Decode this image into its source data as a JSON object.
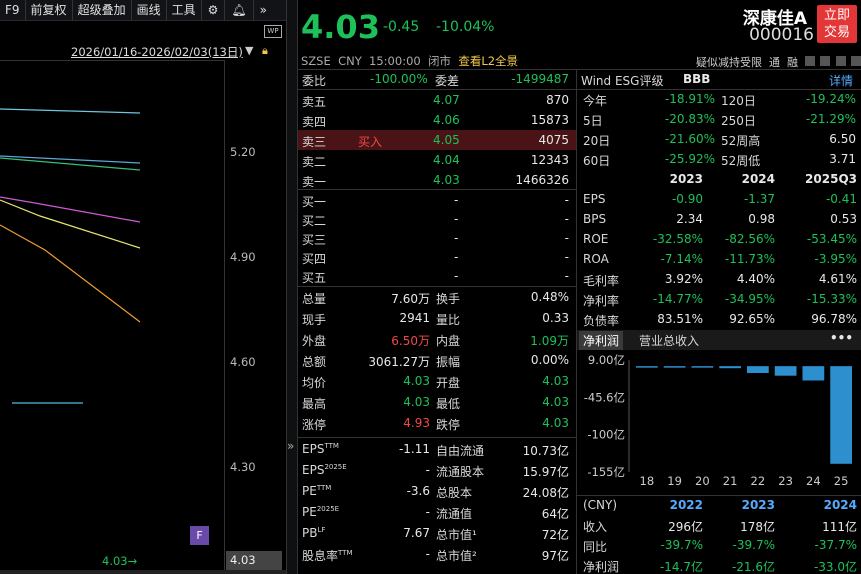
{
  "toolbar": {
    "f9": "F9",
    "restore": "前复权",
    "overlay": "超级叠加",
    "draw": "画线",
    "tools": "工具"
  },
  "chart": {
    "date_range": "2026/01/16-2026/02/03(13日)",
    "y_ticks": [
      "5.20",
      "4.90",
      "4.60",
      "4.30"
    ],
    "last_label": "4.03",
    "last_arrow": "4.03→",
    "f_marker": "F"
  },
  "header": {
    "price": "4.03",
    "change": "-0.45",
    "change_pct": "-10.04%",
    "name": "深康佳A",
    "code": "000016",
    "trade_btn_line1": "立即",
    "trade_btn_line2": "交易",
    "exchange": "SZSE",
    "currency": "CNY",
    "time": "15:00:00",
    "status": "闭市",
    "l2": "查看L2全景",
    "notice": "疑似减持受限",
    "notice2": "通",
    "notice3": "融"
  },
  "book": {
    "ratio_label": "委比",
    "ratio_value": "-100.00%",
    "diff_label": "委差",
    "diff_value": "-1499487",
    "asks": [
      {
        "label": "卖五",
        "price": "4.07",
        "vol": "870"
      },
      {
        "label": "卖四",
        "price": "4.06",
        "vol": "15873"
      },
      {
        "label": "卖三",
        "tag": "买入",
        "price": "4.05",
        "vol": "4075"
      },
      {
        "label": "卖二",
        "price": "4.04",
        "vol": "12343"
      },
      {
        "label": "卖一",
        "price": "4.03",
        "vol": "1466326"
      }
    ],
    "bids": [
      {
        "label": "买一",
        "price": "-",
        "vol": "-"
      },
      {
        "label": "买二",
        "price": "-",
        "vol": "-"
      },
      {
        "label": "买三",
        "price": "-",
        "vol": "-"
      },
      {
        "label": "买四",
        "price": "-",
        "vol": "-"
      },
      {
        "label": "买五",
        "price": "-",
        "vol": "-"
      }
    ]
  },
  "stats": [
    {
      "l1": "总量",
      "v1": "7.60万",
      "l2": "换手",
      "v2": "0.48%"
    },
    {
      "l1": "现手",
      "v1": "2941",
      "l2": "量比",
      "v2": "0.33"
    },
    {
      "l1": "外盘",
      "v1": "6.50万",
      "l2": "内盘",
      "v2": "1.09万"
    },
    {
      "l1": "总额",
      "v1": "3061.27万",
      "l2": "振幅",
      "v2": "0.00%"
    },
    {
      "l1": "均价",
      "v1": "4.03",
      "l2": "开盘",
      "v2": "4.03"
    },
    {
      "l1": "最高",
      "v1": "4.03",
      "l2": "最低",
      "v2": "4.03"
    },
    {
      "l1": "涨停",
      "v1": "4.93",
      "l2": "跌停",
      "v2": "4.03"
    }
  ],
  "val": [
    {
      "l1": "EPS",
      "s1": "TTM",
      "v1": "-1.11",
      "l2": "自由流通",
      "v2": "10.73亿"
    },
    {
      "l1": "EPS",
      "s1": "2025E",
      "v1": "-",
      "l2": "流通股本",
      "v2": "15.97亿"
    },
    {
      "l1": "PE",
      "s1": "TTM",
      "v1": "-3.6",
      "l2": "总股本",
      "v2": "24.08亿"
    },
    {
      "l1": "PE",
      "s1": "2025E",
      "v1": "-",
      "l2": "流通值",
      "v2": "64亿"
    },
    {
      "l1": "PB",
      "s1": "LF",
      "v1": "7.67",
      "l2": "总市值¹",
      "v2": "72亿"
    },
    {
      "l1": "股息率",
      "s1": "TTM",
      "v1": "-",
      "l2": "总市值²",
      "v2": "97亿"
    }
  ],
  "wind": {
    "title": "Wind ESG评级",
    "rating": "BBB",
    "detail": "详情",
    "perf": [
      {
        "l1": "今年",
        "v1": "-18.91%",
        "l2": "120日",
        "v2": "-19.24%"
      },
      {
        "l1": "5日",
        "v1": "-20.83%",
        "l2": "250日",
        "v2": "-21.29%"
      },
      {
        "l1": "20日",
        "v1": "-21.60%",
        "l2": "52周高",
        "v2": "6.50"
      },
      {
        "l1": "60日",
        "v1": "-25.92%",
        "l2": "52周低",
        "v2": "3.71"
      }
    ],
    "years": [
      "2023",
      "2024",
      "2025Q3"
    ],
    "fin": [
      {
        "l": "EPS",
        "v": [
          "-0.90",
          "-1.37",
          "-0.41"
        ]
      },
      {
        "l": "BPS",
        "v": [
          "2.34",
          "0.98",
          "0.53"
        ]
      },
      {
        "l": "ROE",
        "v": [
          "-32.58%",
          "-82.56%",
          "-53.45%"
        ]
      },
      {
        "l": "ROA",
        "v": [
          "-7.14%",
          "-11.73%",
          "-3.95%"
        ]
      },
      {
        "l": "毛利率",
        "v": [
          "3.92%",
          "4.40%",
          "4.61%"
        ]
      },
      {
        "l": "净利率",
        "v": [
          "-14.77%",
          "-34.95%",
          "-15.33%"
        ]
      },
      {
        "l": "负债率",
        "v": [
          "83.51%",
          "92.65%",
          "96.78%"
        ]
      }
    ],
    "tab1": "净利润",
    "tab2": "营业总收入",
    "more": "•••"
  },
  "chart_data": {
    "type": "bar",
    "categories": [
      "18",
      "19",
      "20",
      "21",
      "22",
      "23",
      "24",
      "25"
    ],
    "values": [
      -1,
      -1,
      -2,
      -3,
      -10,
      -14,
      -21,
      -143
    ],
    "yticks": [
      "9.00亿",
      "-45.6亿",
      "-100亿",
      "-155亿"
    ],
    "ylim": [
      -155,
      9
    ]
  },
  "annual": {
    "unit": "(CNY)",
    "years": [
      "2022",
      "2023",
      "2024"
    ],
    "rows": [
      {
        "l": "收入",
        "v": [
          "296亿",
          "178亿",
          "111亿"
        ]
      },
      {
        "l": "同比",
        "v": [
          "-39.7%",
          "-39.7%",
          "-37.7%"
        ]
      },
      {
        "l": "净利润",
        "v": [
          "-14.7亿",
          "-21.6亿",
          "-33.0亿"
        ]
      }
    ]
  }
}
